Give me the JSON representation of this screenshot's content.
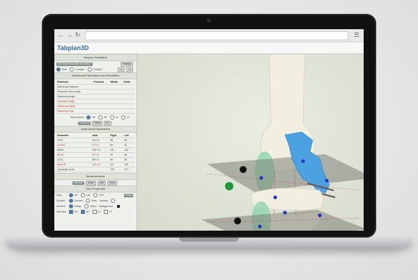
{
  "app": {
    "title": "Tabplan3D"
  },
  "browser": {
    "back_icon": "arrow-left",
    "forward_icon": "arrow-right",
    "reload_icon": "reload",
    "menu_icon": "hamburger"
  },
  "panel": {
    "surgery": {
      "title": "Surgery Simulation",
      "buttons": [
        "Advanced Automatic Simulation",
        "Settings"
      ],
      "radios": [
        {
          "label": "Auto",
          "checked": true
        },
        {
          "label": "Config 1",
          "checked": false
        },
        {
          "label": "Config 2",
          "checked": false
        }
      ],
      "small_buttons": [
        "<<",
        ">>"
      ]
    },
    "osteotomy": {
      "title": "Osteotomy Parameters and Simulation",
      "columns": [
        "Parameter",
        "Proximal",
        "Middle",
        "Distal"
      ],
      "rows": [
        {
          "name": "Osteotomy Distance",
          "red": false
        },
        {
          "name": "Deformity Plane Angle",
          "red": false
        },
        {
          "name": "Osteotomy Angle",
          "red": false
        },
        {
          "name": "Correction Angle",
          "red": true
        },
        {
          "name": "Osteotomy Width",
          "red": true
        },
        {
          "name": "Osteotomy Gap",
          "red": true
        }
      ],
      "select_bone_label": "Select Bone",
      "bone_options": [
        "RF",
        "RT",
        "LF",
        "LT"
      ],
      "action_buttons": [
        "Cut Bone",
        "Reset",
        "Fix"
      ]
    },
    "anatomical": {
      "title": "Anatomical Parameters",
      "columns": [
        "Parameter",
        "Ideal",
        "Right",
        "Left"
      ],
      "rows": [
        {
          "name": "LPFA",
          "ideal": "90+/-5",
          "right": "88",
          "left": "85",
          "red": false
        },
        {
          "name": "mLDFA",
          "ideal": "87+/-3",
          "right": "85",
          "left": "84",
          "red": true
        },
        {
          "name": "MNSA",
          "ideal": "130+/-6",
          "right": "131",
          "left": "126",
          "red": false
        },
        {
          "name": "MPTA",
          "ideal": "87+/-3",
          "right": "87",
          "left": "86",
          "red": true
        },
        {
          "name": "LDTA",
          "ideal": "89+/-3",
          "right": "89",
          "left": "88",
          "red": false
        },
        {
          "name": "ANA-HP",
          "ideal": "130+/-6",
          "right": "127",
          "left": "128",
          "red": true
        },
        {
          "name": "Leg length (mm)",
          "ideal": "",
          "right": "799",
          "left": "817",
          "red": false
        }
      ]
    },
    "measurements": {
      "title": "Measurements",
      "buttons": [
        "Distance",
        "Angle",
        "Add",
        "Clear"
      ]
    },
    "view": {
      "title": "View Properties",
      "rows": [
        {
          "label": "View",
          "options": [
            "AP",
            "LAT",
            "TOP"
          ],
          "checked": 0,
          "button": "Reset"
        },
        {
          "label": "Surface",
          "options": [
            "Smooth",
            "Wire",
            "Opacity"
          ],
          "checked": 0
        },
        {
          "label": "Camera",
          "options": [
            "Persp.",
            "Ortho",
            "Background"
          ],
          "checked": 0
        },
        {
          "label": "Selected",
          "options": [
            "RF",
            "RT",
            "LF",
            "LT"
          ],
          "checked": 0
        }
      ]
    }
  },
  "colors": {
    "bone": "#f3efe0",
    "plate": "#4aa3e0",
    "plane": "#7d8178",
    "green_handle": "#1a9a3a",
    "blue_point": "#2433c8",
    "mint_disc": "#8fd6b2"
  }
}
